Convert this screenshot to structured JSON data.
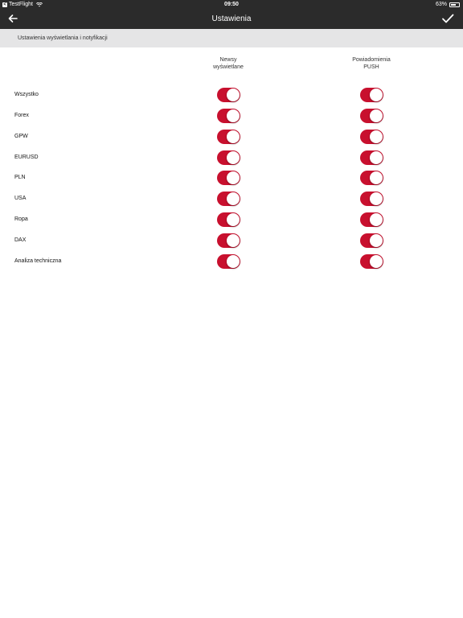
{
  "status_bar": {
    "back_chip": "<",
    "app_name": "TestFlight",
    "time": "09:50",
    "battery_percent": "63%",
    "battery_level": 0.63
  },
  "nav": {
    "title": "Ustawienia",
    "back_icon": "arrow-left-icon",
    "confirm_icon": "checkmark-icon"
  },
  "section": {
    "title": "Ustawienia wyświetlania i notyfikacji"
  },
  "columns": {
    "news": "Newsy\nwyświetlane",
    "push": "Powiadomienia\nPUSH"
  },
  "colors": {
    "toggle_on": "#c8102e",
    "bar": "#2b2b2b",
    "section_bg": "#e5e5e6"
  },
  "rows": [
    {
      "label": "Wszystko",
      "news": true,
      "push": true
    },
    {
      "label": "Forex",
      "news": true,
      "push": true
    },
    {
      "label": "GPW",
      "news": true,
      "push": true
    },
    {
      "label": "EURUSD",
      "news": true,
      "push": true
    },
    {
      "label": "PLN",
      "news": true,
      "push": true
    },
    {
      "label": "USA",
      "news": true,
      "push": true
    },
    {
      "label": "Ropa",
      "news": true,
      "push": true
    },
    {
      "label": "DAX",
      "news": true,
      "push": true
    },
    {
      "label": "Analiza techniczna",
      "news": true,
      "push": true
    }
  ]
}
